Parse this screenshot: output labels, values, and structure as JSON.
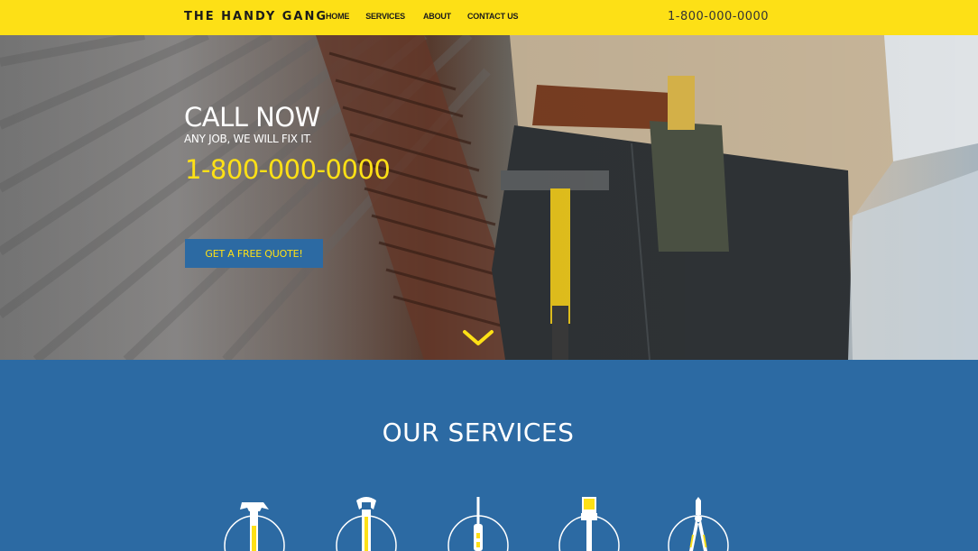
{
  "header": {
    "brand": "THE HANDY GANG",
    "nav": [
      "HOME",
      "SERVICES",
      "ABOUT",
      "CONTACT US"
    ],
    "phone": "1-800-000-0000"
  },
  "hero": {
    "title": "CALL NOW",
    "subtitle": "ANY JOB, WE WILL FIX IT.",
    "phone": "1-800-000-0000",
    "cta_label": "GET A FREE QUOTE!",
    "scroll_icon": "chevron-down-icon"
  },
  "services": {
    "title": "OUR SERVICES",
    "icons": [
      "hammer-icon",
      "wrench-icon",
      "screwdriver-icon",
      "paintbrush-icon",
      "pliers-icon"
    ]
  },
  "colors": {
    "header_bg": "#fde016",
    "accent_yellow": "#fde016",
    "brand_blue": "#2c6aa3",
    "text_dark": "#1b1b1b",
    "white": "#ffffff"
  }
}
